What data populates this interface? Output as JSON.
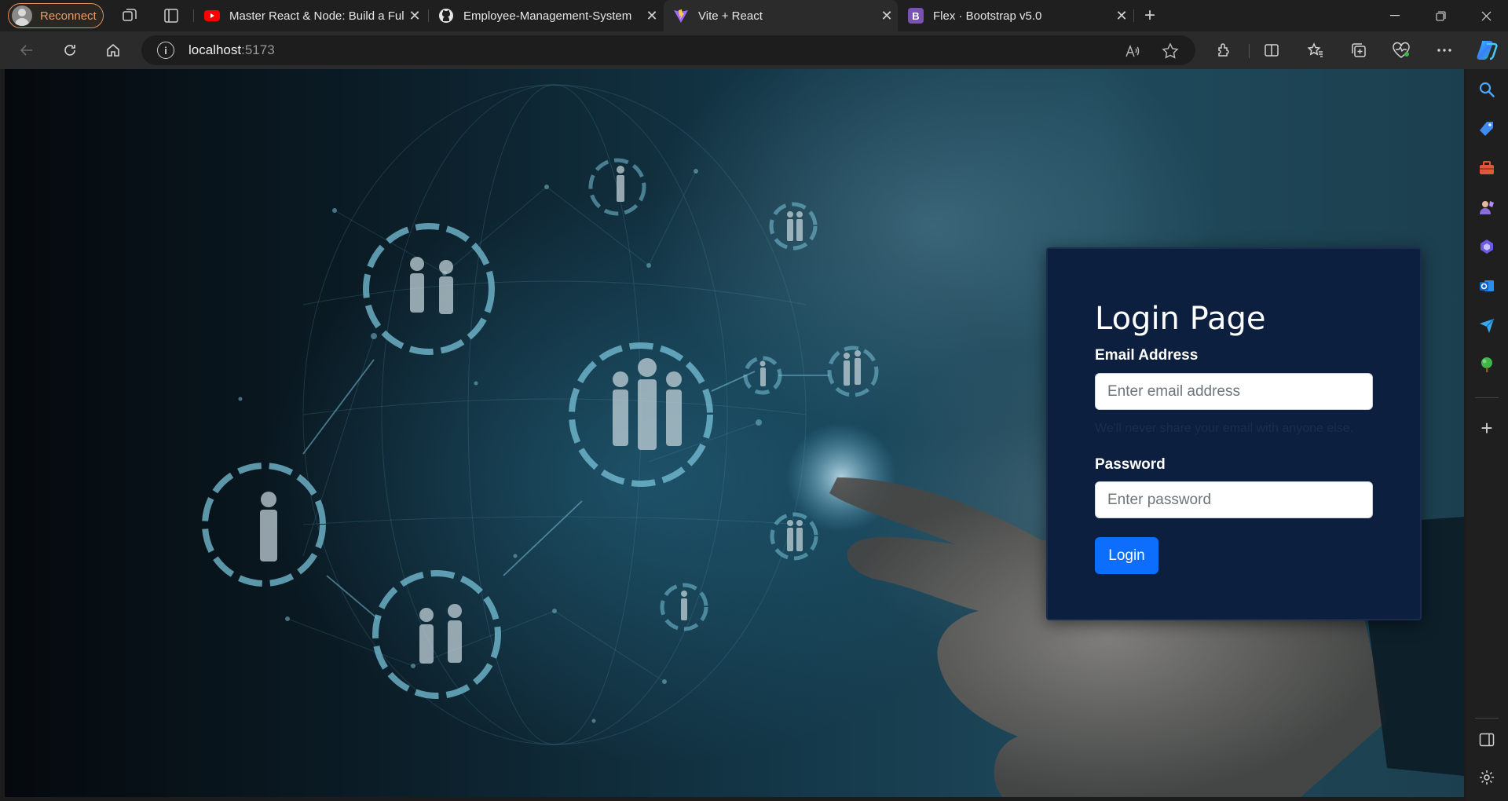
{
  "browser": {
    "profile_label": "Reconnect",
    "tabs": [
      {
        "title": "Master React & Node: Build a Ful",
        "favicon": "youtube-icon",
        "active": false
      },
      {
        "title": "Employee-Management-System",
        "favicon": "github-icon",
        "active": false
      },
      {
        "title": "Vite + React",
        "favicon": "vite-icon",
        "active": true
      },
      {
        "title": "Flex · Bootstrap v5.0",
        "favicon": "bootstrap-icon",
        "active": false
      }
    ],
    "url_host": "localhost",
    "url_port": ":5173"
  },
  "login": {
    "title": "Login Page",
    "email_label": "Email Address",
    "email_placeholder": "Enter email address",
    "email_help": "We'll never share your email with anyone else.",
    "password_label": "Password",
    "password_placeholder": "Enter password",
    "submit_label": "Login"
  },
  "colors": {
    "card_bg": "#0d1f3f",
    "primary_button": "#0d6efd",
    "profile_accent": "#e79e6a"
  }
}
